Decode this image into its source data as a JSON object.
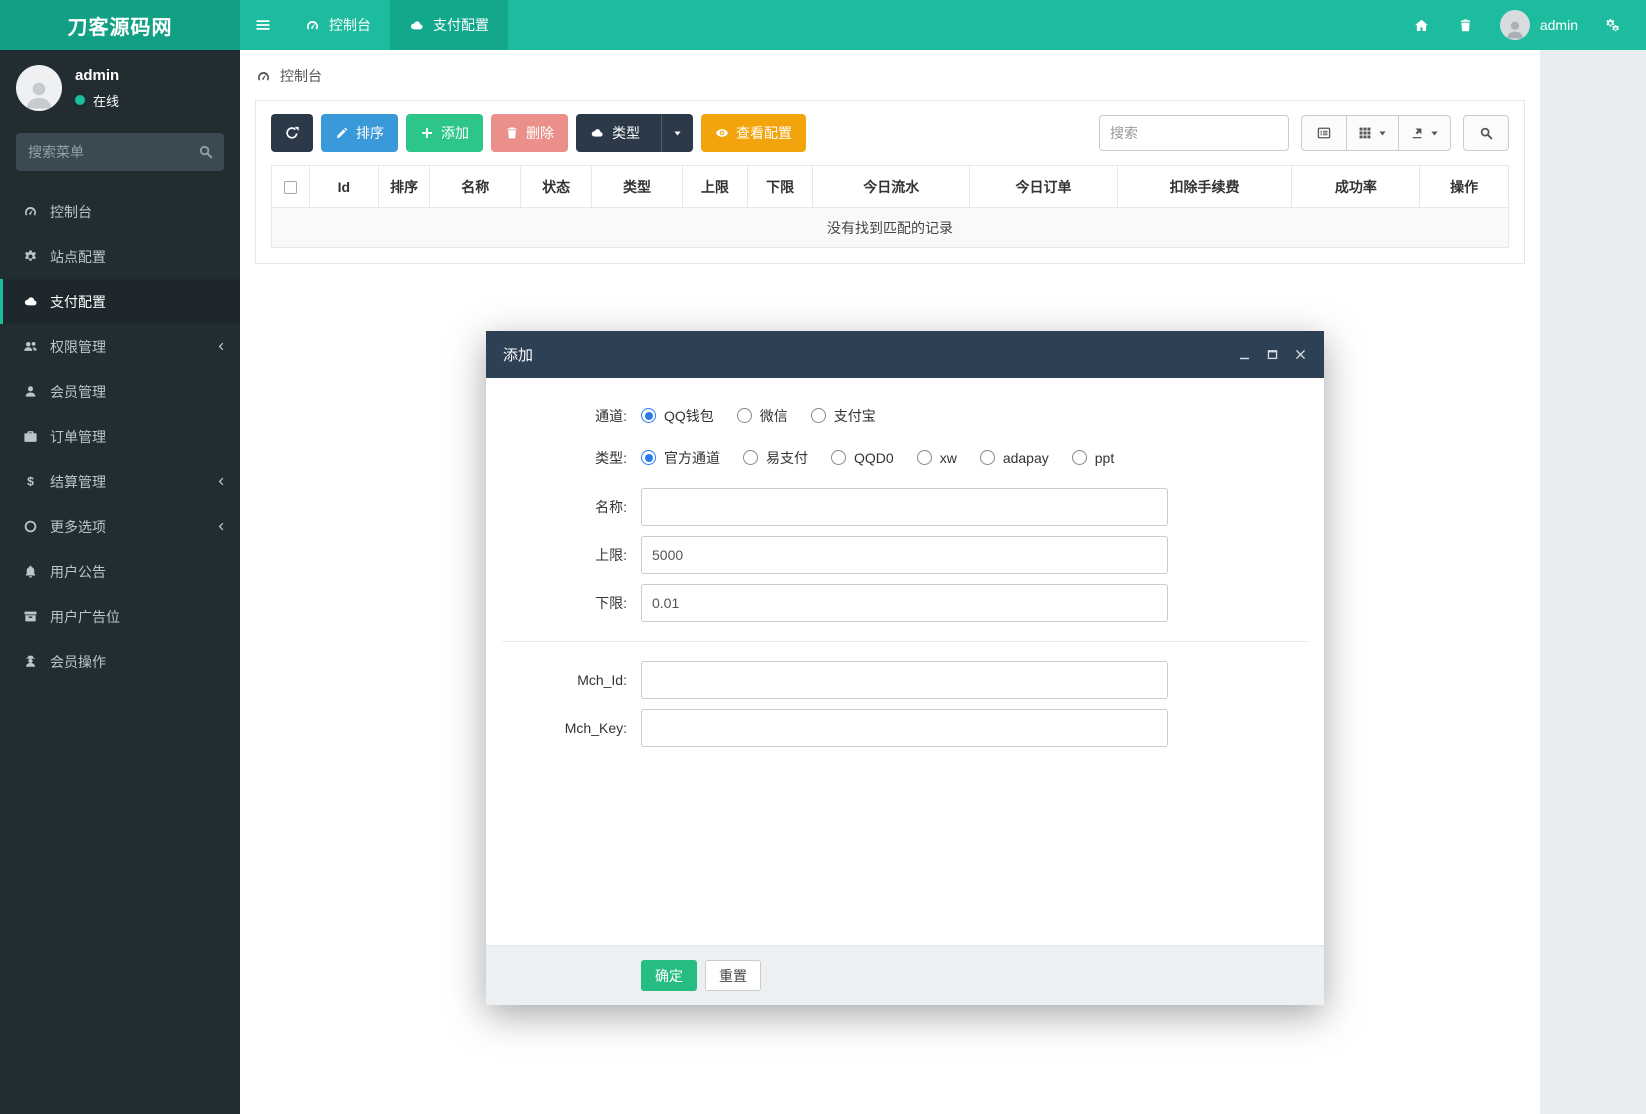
{
  "navbar": {
    "brand": "刀客源码网",
    "tabs": [
      {
        "name": "dashboard",
        "label": "控制台",
        "icon": "gauge",
        "active": false
      },
      {
        "name": "payment-config",
        "label": "支付配置",
        "icon": "cloud",
        "active": true
      }
    ],
    "user": "admin"
  },
  "sidebar": {
    "user": {
      "name": "admin",
      "status": "在线"
    },
    "search_placeholder": "搜索菜单",
    "menu": [
      {
        "name": "dashboard",
        "label": "控制台",
        "icon": "gauge",
        "active": false,
        "expandable": false
      },
      {
        "name": "site-config",
        "label": "站点配置",
        "icon": "gear",
        "active": false,
        "expandable": false
      },
      {
        "name": "payment-config",
        "label": "支付配置",
        "icon": "cloud",
        "active": true,
        "expandable": false
      },
      {
        "name": "permission-management",
        "label": "权限管理",
        "icon": "users",
        "active": false,
        "expandable": true
      },
      {
        "name": "member-management",
        "label": "会员管理",
        "icon": "user",
        "active": false,
        "expandable": false
      },
      {
        "name": "order-management",
        "label": "订单管理",
        "icon": "briefcase",
        "active": false,
        "expandable": false
      },
      {
        "name": "settlement-management",
        "label": "结算管理",
        "icon": "dollar",
        "active": false,
        "expandable": true
      },
      {
        "name": "more-options",
        "label": "更多选项",
        "icon": "circle-o",
        "active": false,
        "expandable": true
      },
      {
        "name": "user-announcement",
        "label": "用户公告",
        "icon": "bell",
        "active": false,
        "expandable": false
      },
      {
        "name": "user-ad-slot",
        "label": "用户广告位",
        "icon": "archive",
        "active": false,
        "expandable": false
      },
      {
        "name": "member-operation",
        "label": "会员操作",
        "icon": "user-secret",
        "active": false,
        "expandable": false
      }
    ]
  },
  "breadcrumb": {
    "label": "控制台"
  },
  "toolbar": {
    "sort_label": "排序",
    "add_label": "添加",
    "delete_label": "删除",
    "type_label": "类型",
    "view_config_label": "查看配置",
    "search_placeholder": "搜索"
  },
  "table": {
    "columns": [
      "Id",
      "排序",
      "名称",
      "状态",
      "类型",
      "上限",
      "下限",
      "今日流水",
      "今日订单",
      "扣除手续费",
      "成功率",
      "操作"
    ],
    "empty_text": "没有找到匹配的记录"
  },
  "modal": {
    "title": "添加",
    "fields": {
      "channel": {
        "label": "通道:",
        "options": [
          "QQ钱包",
          "微信",
          "支付宝"
        ],
        "selected": "QQ钱包"
      },
      "type": {
        "label": "类型:",
        "options": [
          "官方通道",
          "易支付",
          "QQD0",
          "xw",
          "adapay",
          "ppt"
        ],
        "selected": "官方通道"
      },
      "name": {
        "label": "名称:",
        "value": ""
      },
      "upper": {
        "label": "上限:",
        "value": "5000"
      },
      "lower": {
        "label": "下限:",
        "value": "0.01"
      },
      "mch_id": {
        "label": "Mch_Id:",
        "value": ""
      },
      "mch_key": {
        "label": "Mch_Key:",
        "value": ""
      }
    },
    "confirm_label": "确定",
    "reset_label": "重置"
  },
  "icons": {
    "menu-icon": "☰ hamburger",
    "gauge-icon": "dashboard speedometer",
    "cloud-icon": "cloud",
    "home-icon": "house",
    "trash-icon": "trash can",
    "cogs-icon": "double gears",
    "search-icon": "magnifier",
    "pencil-icon": "edit pencil",
    "plus-icon": "plus",
    "eye-icon": "eye",
    "refresh-icon": "circular arrows",
    "caret-down-icon": "▼",
    "chevron-left-icon": "‹",
    "list-alt-icon": "bordered list",
    "grid-icon": "3x3 grid",
    "export-icon": "export arrow",
    "window-minimize-icon": "—",
    "window-maximize-icon": "❐",
    "window-close-icon": "✕",
    "person-icon": "user silhouette"
  },
  "colors": {
    "navbar": "#1ebc9e",
    "navbar_brand": "#12a085",
    "navbar_active_tab": "#13a88c",
    "sidebar": "#222d32",
    "sidebar_active": "#1e282c",
    "accent_teal": "#1dbc9d",
    "btn_dark": "#2b3949",
    "btn_blue": "#3a99d9",
    "btn_green": "#2cc689",
    "btn_red": "#ea8f89",
    "btn_orange": "#f3a30b",
    "modal_header": "#2e4053",
    "radio_blue": "#2a7cee",
    "confirm_green": "#26bd83"
  }
}
